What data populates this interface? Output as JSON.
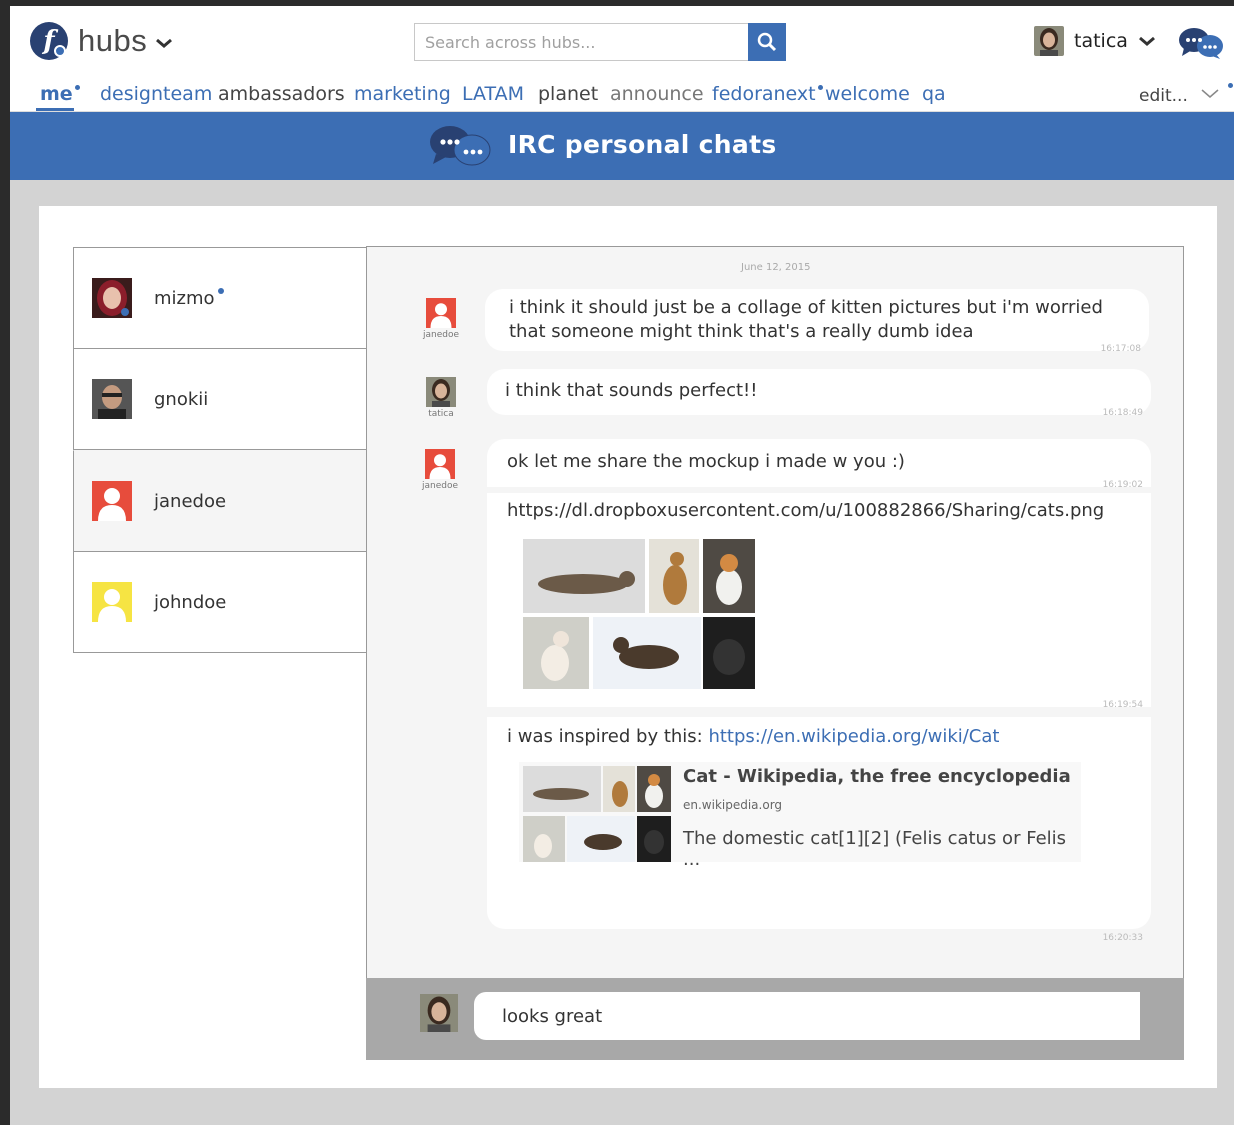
{
  "header": {
    "logo_text": "hubs",
    "search_placeholder": "Search across hubs...",
    "username": "tatica"
  },
  "nav": {
    "items": [
      {
        "label": "me",
        "state": "active",
        "dot": true
      },
      {
        "label": "designteam",
        "state": "blue"
      },
      {
        "label": "ambassadors",
        "state": "gray"
      },
      {
        "label": "marketing",
        "state": "blue"
      },
      {
        "label": "LATAM",
        "state": "blue"
      },
      {
        "label": "planet",
        "state": "gray"
      },
      {
        "label": "announce",
        "state": "light"
      },
      {
        "label": "fedoranext",
        "state": "blue",
        "dot": true
      },
      {
        "label": "welcome",
        "state": "blue"
      },
      {
        "label": "qa",
        "state": "blue"
      }
    ],
    "edit_label": "edit..."
  },
  "banner": {
    "title": "IRC personal chats"
  },
  "contacts": [
    {
      "name": "mizmo",
      "online": true
    },
    {
      "name": "gnokii",
      "online": false
    },
    {
      "name": "janedoe",
      "online": false
    },
    {
      "name": "johndoe",
      "online": false
    }
  ],
  "chat": {
    "date": "June 12, 2015",
    "messages": [
      {
        "author": "janedoe",
        "text": "i think it should just be a collage of kitten pictures but i'm worried that someone might think that's a really dumb idea",
        "time": "16:17:08"
      },
      {
        "author": "tatica",
        "text": "i think that sounds perfect!!",
        "time": "16:18:49"
      },
      {
        "author": "janedoe",
        "text": "ok let me share the mockup i made w you :)",
        "time": "16:19:02"
      },
      {
        "author": "janedoe",
        "link": "https://dl.dropboxusercontent.com/u/100882866/Sharing/cats.png",
        "time": "16:19:54"
      },
      {
        "author": "janedoe",
        "text": "i was inspired by this: ",
        "link": "https://en.wikipedia.org/wiki/Cat",
        "time": "16:20:33"
      }
    ],
    "preview": {
      "title": "Cat - Wikipedia, the free encyclopedia",
      "domain": "en.wikipedia.org",
      "description": "The domestic cat[1][2] (Felis catus or Felis ..."
    }
  },
  "composer": {
    "value": "looks great"
  },
  "colors": {
    "brand_blue": "#3c6eb4",
    "fedora_dark": "#294172",
    "janedoe_avatar": "#e74c3c",
    "johndoe_avatar": "#f6e443"
  },
  "icons": [
    "fedora-logo-icon",
    "search-icon",
    "chevron-down-icon",
    "chat-bubbles-icon",
    "person-placeholder-icon"
  ]
}
